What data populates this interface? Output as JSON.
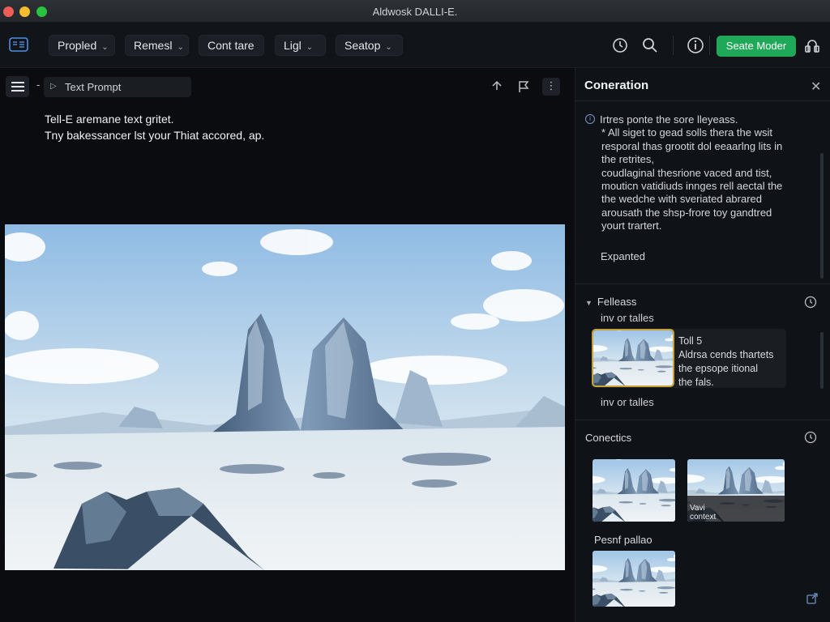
{
  "window": {
    "title": "Aldwosk DALLI-E."
  },
  "toolbar": {
    "menus": [
      {
        "label": "Propled"
      },
      {
        "label": "Remesl"
      },
      {
        "label": "Cont tare"
      },
      {
        "label": "Ligl"
      },
      {
        "label": "Seatop"
      }
    ],
    "create_label": "Seate Moder",
    "accent": "#1fa857"
  },
  "main": {
    "prompt_tab_label": "Text Prompt",
    "separator": "-",
    "prompt_lines": [
      "Tell-E aremane text gritet.",
      "Tny bakessancer lst your Thiat accored, ap."
    ],
    "more_label": "⋮"
  },
  "side": {
    "title": "Coneration",
    "heading": "Irtres ponte the sore lleyeass.",
    "body_lines": [
      "* All siget to gead solls thera the wsit",
      "resporal thas grootit dol eeaarlng lits in",
      "the retrites,",
      "coudlaginal thesrione vaced and tist,",
      "mouticn vatidiuds innges rell aectal the",
      "the wedche with sveriated abrared",
      "arousath the shsp-frore toy gandtred",
      "yourt trartert."
    ],
    "expanded_label": "Expanted",
    "section1": {
      "title": "Felleass",
      "sub_top": "inv or talles",
      "sub_bottom": "inv or talles",
      "card_lines": [
        "Toll 5",
        "Aldrsa cends thartets",
        "the epsope itional",
        "the fals."
      ]
    },
    "section2": {
      "title": "Conectics",
      "thumb_caption": [
        "Vavi",
        "context"
      ]
    },
    "section3": {
      "title": "Pesnf pallao"
    }
  }
}
